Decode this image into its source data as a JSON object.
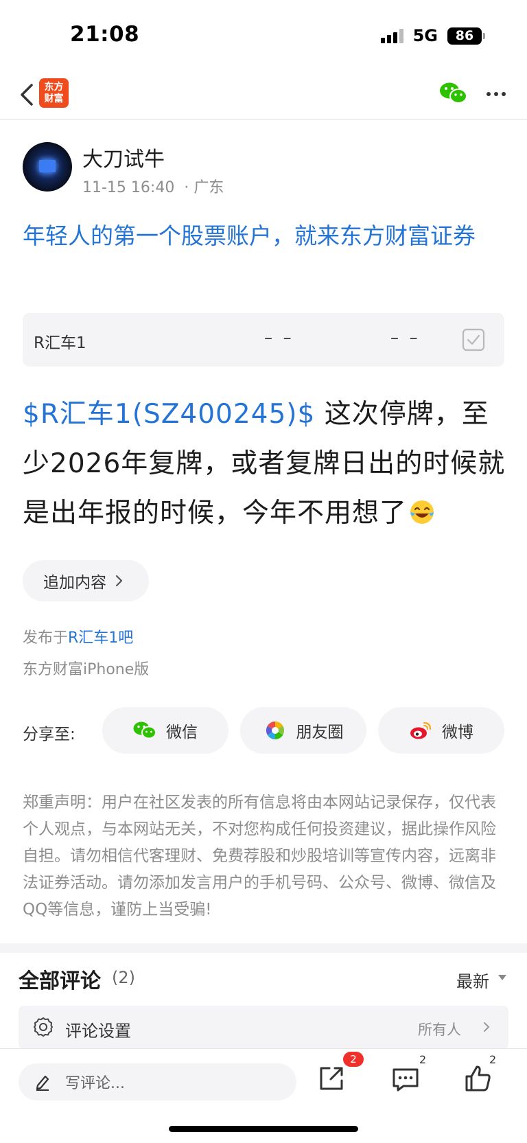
{
  "status_bar": {
    "time": "21:08",
    "network": "5G",
    "battery": "86"
  },
  "nav": {
    "logo_line1": "东方",
    "logo_line2": "财富"
  },
  "author": {
    "name": "大刀试牛",
    "datetime": "11-15 16:40",
    "location": "· 广东"
  },
  "ad_link": "年轻人的第一个股票账户，就来东方财富证券",
  "stock_card": {
    "name": "R汇车1",
    "price": "– –",
    "change": "– –"
  },
  "post": {
    "stock_tag": "$R汇车1(SZ400245)$",
    "text": " 这次停牌，至少2026年复牌，或者复牌日出的时候就是出年报的时候，今年不用想了",
    "emoji": "face-with-tears-of-joy"
  },
  "append_button": "追加内容",
  "publish": {
    "prefix": "发布于",
    "bar_name": "R汇车1吧",
    "client": "东方财富iPhone版"
  },
  "share": {
    "label": "分享至:",
    "wechat": "微信",
    "moments": "朋友圈",
    "weibo": "微博"
  },
  "disclaimer": "郑重声明：用户在社区发表的所有信息将由本网站记录保存，仅代表个人观点，与本网站无关，不对您构成任何投资建议，据此操作风险自担。请勿相信代客理财、免费荐股和炒股培训等宣传内容，远离非法证券活动。请勿添加发言用户的手机号码、公众号、微博、微信及QQ等信息，谨防上当受骗!",
  "comments": {
    "title": "全部评论",
    "count": "(2)",
    "sort": "最新",
    "settings_label": "评论设置",
    "settings_value": "所有人"
  },
  "toolbar": {
    "placeholder": "写评论...",
    "share_badge": "2",
    "comment_count": "2",
    "like_count": "2"
  },
  "colors": {
    "link": "#2474d6",
    "brand": "#f04b1c",
    "badge": "#f0302a",
    "wechat": "#2dc100"
  }
}
